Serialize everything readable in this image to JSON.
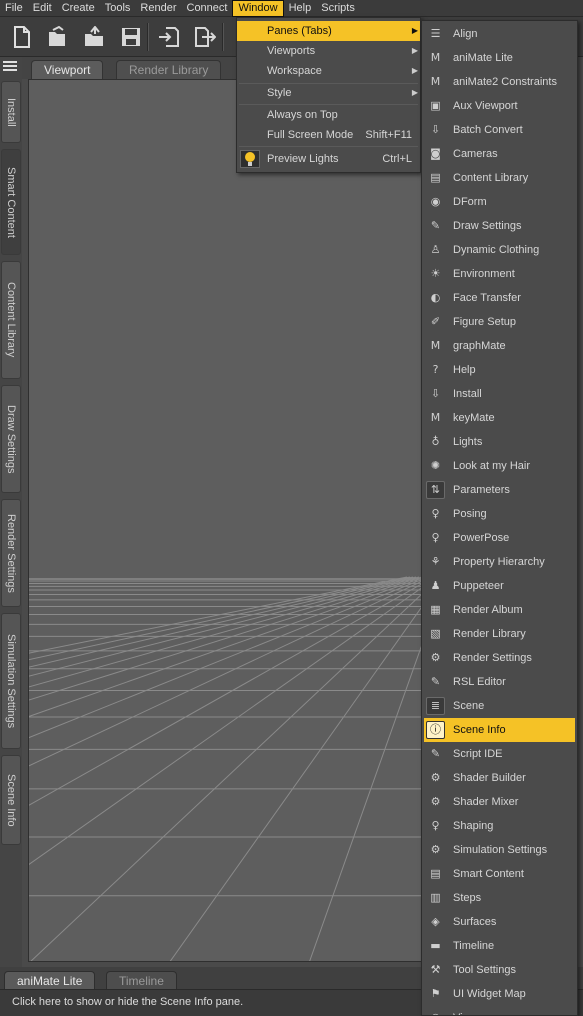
{
  "menubar": {
    "items": [
      "File",
      "Edit",
      "Create",
      "Tools",
      "Render",
      "Connect",
      "Window",
      "Help",
      "Scripts"
    ],
    "active": "Window"
  },
  "toolbar": {
    "icons": [
      "new-file-icon",
      "open-file-icon",
      "merge-file-icon",
      "save-icon",
      "import-icon",
      "export-icon"
    ]
  },
  "viewport_tabs": {
    "viewport": "Viewport",
    "render_library": "Render Library"
  },
  "left_tabs": [
    "Install",
    "Smart Content",
    "Content Library",
    "Draw Settings",
    "Render Settings",
    "Simulation Settings",
    "Scene Info"
  ],
  "window_menu": {
    "panes": "Panes (Tabs)",
    "viewports": "Viewports",
    "workspace": "Workspace",
    "style": "Style",
    "always_on_top": "Always on Top",
    "full_screen": "Full Screen Mode",
    "full_screen_shortcut": "Shift+F11",
    "preview_lights": "Preview Lights",
    "preview_lights_shortcut": "Ctrl+L"
  },
  "panes_menu": {
    "items": [
      {
        "label": "Align",
        "icon": "align-icon"
      },
      {
        "label": "aniMate Lite",
        "icon": "animate-figure-icon"
      },
      {
        "label": "aniMate2 Constraints",
        "icon": "animate-constraints-icon"
      },
      {
        "label": "Aux Viewport",
        "icon": "aux-viewport-icon"
      },
      {
        "label": "Batch Convert",
        "icon": "batch-convert-icon"
      },
      {
        "label": "Cameras",
        "icon": "camera-icon"
      },
      {
        "label": "Content Library",
        "icon": "book-icon"
      },
      {
        "label": "DForm",
        "icon": "dform-icon"
      },
      {
        "label": "Draw Settings",
        "icon": "draw-settings-icon"
      },
      {
        "label": "Dynamic Clothing",
        "icon": "clothing-icon"
      },
      {
        "label": "Environment",
        "icon": "environment-icon"
      },
      {
        "label": "Face Transfer",
        "icon": "face-icon"
      },
      {
        "label": "Figure Setup",
        "icon": "figure-setup-icon"
      },
      {
        "label": "graphMate",
        "icon": "graphmate-icon"
      },
      {
        "label": "Help",
        "icon": "help-icon"
      },
      {
        "label": "Install",
        "icon": "install-icon"
      },
      {
        "label": "keyMate",
        "icon": "keymate-icon"
      },
      {
        "label": "Lights",
        "icon": "light-bulb-icon"
      },
      {
        "label": "Look at my Hair",
        "icon": "hair-icon"
      },
      {
        "label": "Parameters",
        "icon": "parameters-icon"
      },
      {
        "label": "Posing",
        "icon": "posing-icon"
      },
      {
        "label": "PowerPose",
        "icon": "powerpose-icon"
      },
      {
        "label": "Property Hierarchy",
        "icon": "property-hierarchy-icon"
      },
      {
        "label": "Puppeteer",
        "icon": "puppeteer-icon"
      },
      {
        "label": "Render Album",
        "icon": "render-album-icon"
      },
      {
        "label": "Render Library",
        "icon": "render-library-icon"
      },
      {
        "label": "Render Settings",
        "icon": "render-settings-icon"
      },
      {
        "label": "RSL Editor",
        "icon": "rsl-editor-icon"
      },
      {
        "label": "Scene",
        "icon": "scene-icon"
      },
      {
        "label": "Scene Info",
        "icon": "scene-info-icon"
      },
      {
        "label": "Script IDE",
        "icon": "script-ide-icon"
      },
      {
        "label": "Shader Builder",
        "icon": "shader-builder-icon"
      },
      {
        "label": "Shader Mixer",
        "icon": "shader-mixer-icon"
      },
      {
        "label": "Shaping",
        "icon": "shaping-icon"
      },
      {
        "label": "Simulation Settings",
        "icon": "simulation-settings-icon"
      },
      {
        "label": "Smart Content",
        "icon": "smart-content-icon"
      },
      {
        "label": "Steps",
        "icon": "steps-icon"
      },
      {
        "label": "Surfaces",
        "icon": "surfaces-icon"
      },
      {
        "label": "Timeline",
        "icon": "timeline-icon"
      },
      {
        "label": "Tool Settings",
        "icon": "tool-settings-icon"
      },
      {
        "label": "UI Widget Map",
        "icon": "ui-widget-map-icon"
      },
      {
        "label": "View",
        "icon": "view-icon"
      }
    ],
    "highlighted": "Scene Info"
  },
  "bottom_tabs": {
    "animate_lite": "aniMate Lite",
    "timeline": "Timeline"
  },
  "status": "Click here to show or hide the Scene Info pane.",
  "colors": {
    "highlight": "#f5c226",
    "menu_bg": "#4b4b4b",
    "viewport_bg": "#5e5e5e",
    "grid_line": "#8a8a8a"
  }
}
